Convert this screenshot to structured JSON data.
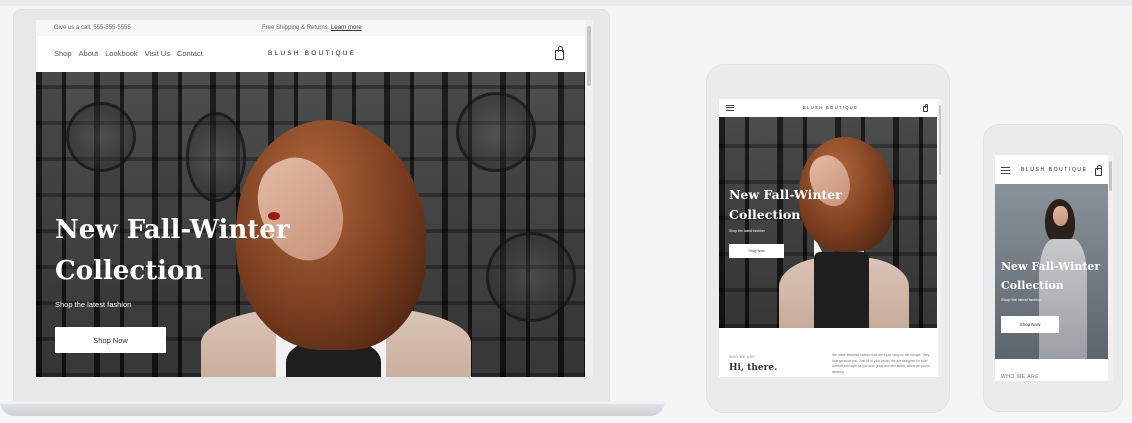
{
  "desktop": {
    "topbar": {
      "call_text": "Give us a call: 555-555-5555",
      "shipping_text": "Free Shipping & Returns.",
      "shipping_link": "Learn more"
    },
    "nav": {
      "links": [
        "Shop",
        "About",
        "Lookbook",
        "Visit Us",
        "Contact"
      ],
      "brand": "BLUSH BOUTIQUE",
      "cart_icon": "shopping-bag-icon"
    },
    "hero": {
      "title": "New Fall-Winter Collection",
      "subtitle": "Shop the latest fashion",
      "button": "Shop Now"
    }
  },
  "tablet": {
    "nav": {
      "brand": "BLUSH BOUTIQUE",
      "menu_icon": "hamburger-icon",
      "cart_icon": "shopping-bag-icon"
    },
    "hero": {
      "title": "New Fall-Winter Collection",
      "subtitle": "Shop the latest fashion",
      "button": "Shop Now"
    },
    "about": {
      "kicker": "WHO WE ARE",
      "title": "Hi, there.",
      "text": "We make beautiful clothes that don't just hang on the hanger. They look great on you. Just fill in your vision; we are designed for both comfort and style so you look great and feel better, wherever you're wearing"
    }
  },
  "phone": {
    "nav": {
      "brand": "BLUSH BOUTIQUE",
      "menu_icon": "hamburger-icon",
      "cart_icon": "shopping-bag-icon"
    },
    "hero": {
      "title": "New Fall-Winter Collection",
      "subtitle": "Shop the latest fashion",
      "button": "Shop Now"
    },
    "about": {
      "kicker": "WHO WE ARE"
    }
  },
  "colors": {
    "accent_text": "#222222",
    "hero_dark": "#2a2a2a",
    "hair": "#a85a32",
    "lips": "#9a1818"
  }
}
